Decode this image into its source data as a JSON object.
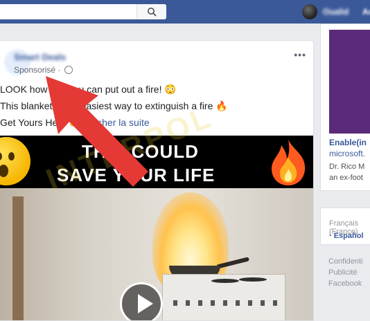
{
  "topbar": {
    "search_placeholder": "",
    "user_name": "Oualid",
    "extra": "Ac"
  },
  "post": {
    "page_name": "Smart Deals",
    "sponsored_label": "Sponsorisé ·",
    "more_label": "•••",
    "line1": "LOOK how fast you can put out a fire! 😳",
    "line2_a": "This blanket is the easiest way to extinguish a fire 🔥",
    "line3_a": "Get Yours Here 👉",
    "see_more": "Afficher la suite",
    "video_caption_line1": "THIS COULD",
    "video_caption_line2": "SAVE YOUR LIFE",
    "watermark": "INTERPOL"
  },
  "sidebar": {
    "ad_title": "Enable(in",
    "ad_url": "microsoft.",
    "ad_desc_line1": "Dr. Rico M",
    "ad_desc_line2": "an ex-foot",
    "lang_current": "Français (France)",
    "lang_alt": "· Español",
    "footer": [
      "Confidenti",
      "Publicité",
      "Facebook"
    ]
  },
  "colors": {
    "brand": "#3b5998",
    "link": "#385898",
    "arrow": "#e53935"
  },
  "icons": {
    "search": "search-icon",
    "globe": "globe-icon",
    "play": "play-icon",
    "more": "more-icon"
  }
}
